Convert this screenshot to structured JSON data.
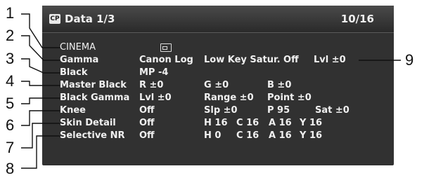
{
  "header": {
    "icon_text": "CP",
    "title": "Data 1/3",
    "page": "10/16"
  },
  "cinema": "CINEMA",
  "rows": [
    {
      "label": "Gamma",
      "v1": "Canon Log",
      "v2": "Low Key Satur. Off",
      "v3": "Lvl ±0"
    },
    {
      "label": "Black",
      "v1": "MP -4"
    },
    {
      "label": "Master Black",
      "v1": "R ±0",
      "v2": "G ±0",
      "v3": "B ±0"
    },
    {
      "label": "Black Gamma",
      "v1": "Lvl ±0",
      "v2": "Range ±0",
      "v3": "Point ±0"
    },
    {
      "label": "Knee",
      "v1": "Off",
      "v2": "Slp ±0",
      "v3": "P 95",
      "v4": "Sat ±0"
    },
    {
      "label": "Skin Detail",
      "v1": "Off",
      "v2": "H 16",
      "v3": "C 16",
      "v4": "A 16",
      "v5": "Y 16"
    },
    {
      "label": "Selective NR",
      "v1": "Off",
      "v2": "H 0",
      "v3": "C 16",
      "v4": "A 16",
      "v5": "Y 16"
    }
  ],
  "callouts": [
    "1",
    "2",
    "3",
    "4",
    "5",
    "6",
    "7",
    "8",
    "9"
  ]
}
